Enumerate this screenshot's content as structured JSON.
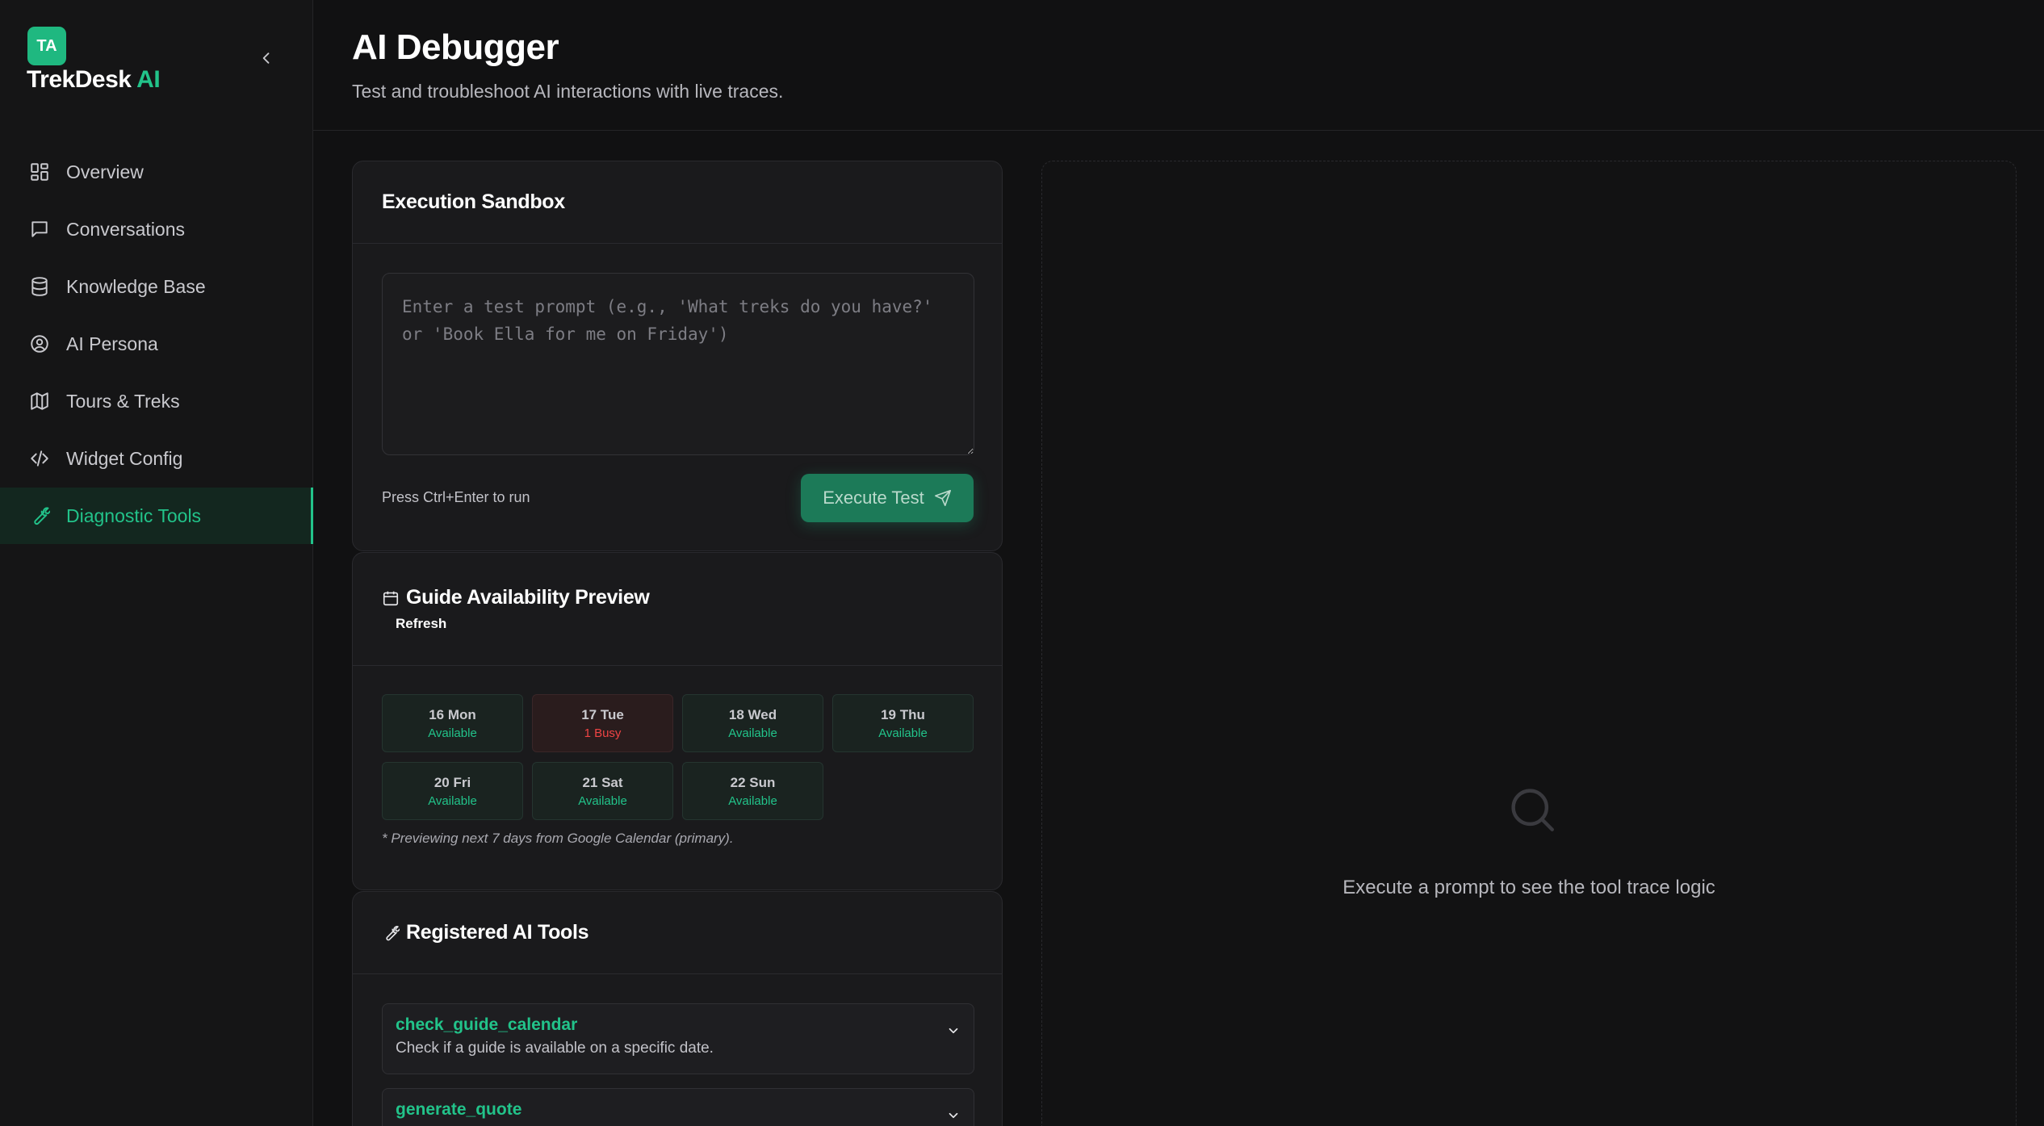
{
  "brand": {
    "badge": "TA",
    "name": "TrekDesk",
    "name_accent": "AI",
    "accent_color": "#22c38a"
  },
  "sidebar": {
    "items": [
      {
        "label": "Overview",
        "icon": "grid-icon",
        "active": false
      },
      {
        "label": "Conversations",
        "icon": "chat-bubble-icon",
        "active": false
      },
      {
        "label": "Knowledge Base",
        "icon": "database-icon",
        "active": false
      },
      {
        "label": "AI Persona",
        "icon": "user-circle-icon",
        "active": false
      },
      {
        "label": "Tours & Treks",
        "icon": "map-icon",
        "active": false
      },
      {
        "label": "Widget Config",
        "icon": "code-icon",
        "active": false
      },
      {
        "label": "Diagnostic Tools",
        "icon": "wrench-icon",
        "active": true
      }
    ]
  },
  "header": {
    "title": "AI Debugger",
    "subtitle": "Test and troubleshoot AI interactions with live traces."
  },
  "sandbox": {
    "title": "Execution Sandbox",
    "prompt_value": "",
    "prompt_placeholder": "Enter a test prompt (e.g., 'What treks do you have?' or 'Book Ella for me on Friday')",
    "hint": "Press Ctrl+Enter to run",
    "execute_label": "Execute Test"
  },
  "availability": {
    "title": "Guide Availability Preview",
    "refresh_label": "Refresh",
    "days": [
      {
        "day": "16 Mon",
        "status": "Available",
        "busy": false
      },
      {
        "day": "17 Tue",
        "status": "1 Busy",
        "busy": true
      },
      {
        "day": "18 Wed",
        "status": "Available",
        "busy": false
      },
      {
        "day": "19 Thu",
        "status": "Available",
        "busy": false
      },
      {
        "day": "20 Fri",
        "status": "Available",
        "busy": false
      },
      {
        "day": "21 Sat",
        "status": "Available",
        "busy": false
      },
      {
        "day": "22 Sun",
        "status": "Available",
        "busy": false
      }
    ],
    "note": "* Previewing next 7 days from Google Calendar (primary)."
  },
  "tools": {
    "title": "Registered AI Tools",
    "items": [
      {
        "name": "check_guide_calendar",
        "description": "Check if a guide is available on a specific date."
      },
      {
        "name": "generate_quote",
        "description": ""
      }
    ]
  },
  "trace": {
    "empty_message": "Execute a prompt to see the tool trace logic"
  }
}
